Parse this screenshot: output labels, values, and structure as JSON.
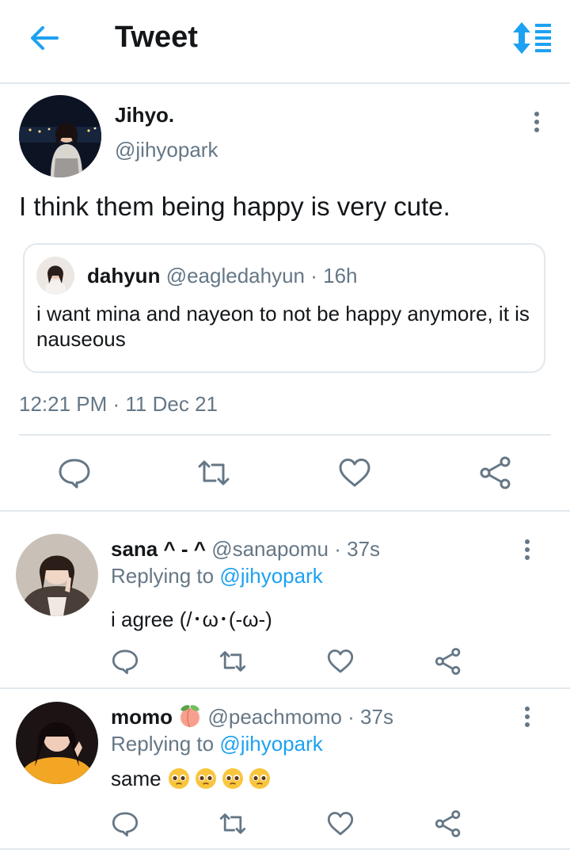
{
  "header": {
    "title": "Tweet",
    "back_icon": "arrow-left-icon",
    "sort_icon": "sort-timeline-icon",
    "accent": "#1da1f2"
  },
  "tweet": {
    "author_name": "Jihyo.",
    "author_handle": "@jihyopark",
    "text": "I think them being happy is very cute.",
    "timestamp": "12:21 PM · 11 Dec 21",
    "quote": {
      "name": "dahyun",
      "handle_time": "@eagledahyun · 16h",
      "text": "i want mina and nayeon to not be happy anymore, it is nauseous"
    }
  },
  "actions": [
    "reply-icon",
    "retweet-icon",
    "like-icon",
    "share-icon"
  ],
  "replies": [
    {
      "name": "sana ^ - ^",
      "handle_time": "@sanapomu · 37s",
      "replying_prefix": "Replying to ",
      "replying_mention": "@jihyopark",
      "text": "i agree (/･ω･(-ω-)"
    },
    {
      "name": "momo",
      "name_emoji": "peach-emoji",
      "handle_time": "@peachmomo · 37s",
      "replying_prefix": "Replying to ",
      "replying_mention": "@jihyopark",
      "text": "same",
      "text_emojis": [
        "pleading-face-emoji",
        "pleading-face-emoji",
        "pleading-face-emoji",
        "pleading-face-emoji"
      ]
    }
  ],
  "colors": {
    "text": "#14171a",
    "secondary": "#657786",
    "accent": "#1da1f2",
    "divider": "#e1e8ed"
  }
}
